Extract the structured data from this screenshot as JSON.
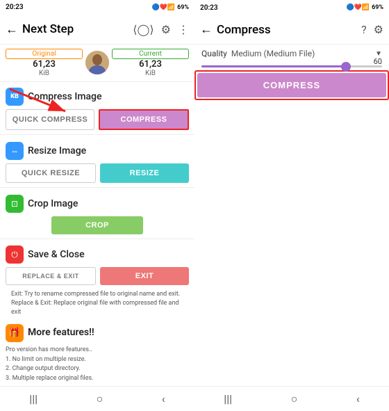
{
  "leftScreen": {
    "statusBar": {
      "time": "20:23",
      "battery": "69%",
      "signal": "📶"
    },
    "topNav": {
      "title": "Next Step",
      "backLabel": "←",
      "shareIcon": "share",
      "settingsIcon": "⚙",
      "moreIcon": "⋮"
    },
    "imageInfo": {
      "originalLabel": "Original",
      "originalSize": "61,23",
      "originalUnit": "KiB",
      "currentLabel": "Current",
      "currentSize": "61,23",
      "currentUnit": "KiB"
    },
    "sections": [
      {
        "id": "compress",
        "icon": "KB",
        "iconColor": "blue",
        "title": "Compress Image",
        "buttons": [
          {
            "label": "QUICK COMPRESS",
            "style": "outline"
          },
          {
            "label": "COMPRESS",
            "style": "purple",
            "highlight": true
          }
        ]
      },
      {
        "id": "resize",
        "icon": "⇔",
        "iconColor": "blue",
        "title": "Resize Image",
        "buttons": [
          {
            "label": "QUICK RESIZE",
            "style": "outline"
          },
          {
            "label": "RESIZE",
            "style": "teal"
          }
        ]
      },
      {
        "id": "crop",
        "icon": "⊡",
        "iconColor": "green",
        "title": "Crop Image",
        "buttons": [
          {
            "label": "CROP",
            "style": "green",
            "single": true
          }
        ]
      },
      {
        "id": "save",
        "icon": "⏻",
        "iconColor": "red",
        "title": "Save & Close",
        "buttons": [
          {
            "label": "REPLACE & EXIT",
            "style": "outline"
          },
          {
            "label": "EXIT",
            "style": "red"
          }
        ],
        "note": "Exit: Try to rename compressed file to original name and exit.\nReplace & Exit: Replace original file with compressed file and exit"
      }
    ],
    "moreSection": {
      "title": "More features!!",
      "text": "Pro version has more features..\n1. No limit on multiple resize.\n2. Change output directory.\n3. Multiple replace original files."
    },
    "bottomNav": [
      "|||",
      "○",
      "<"
    ]
  },
  "rightScreen": {
    "statusBar": {
      "time": "20:23",
      "battery": "69%"
    },
    "topNav": {
      "title": "Compress",
      "backLabel": "←",
      "helpIcon": "?",
      "settingsIcon": "⚙"
    },
    "quality": {
      "label": "Quality",
      "value": "Medium (Medium File)",
      "sliderValue": "60",
      "sliderPercent": 80
    },
    "compressButton": {
      "label": "COMPRESS",
      "highlight": true
    },
    "bottomNav": [
      "|||",
      "○",
      "<"
    ]
  }
}
